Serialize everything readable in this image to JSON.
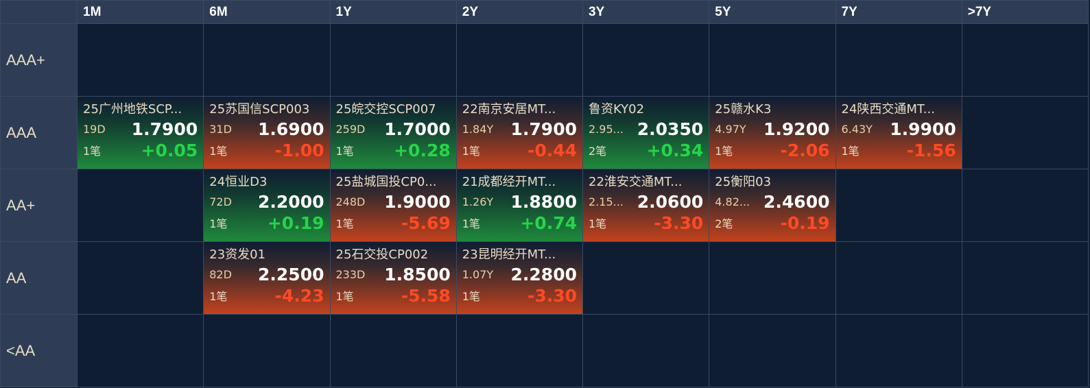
{
  "columns": [
    "1M",
    "6M",
    "1Y",
    "2Y",
    "3Y",
    "5Y",
    "7Y",
    ">7Y"
  ],
  "rows": [
    "AAA+",
    "AAA",
    "AA+",
    "AA",
    "<AA"
  ],
  "colors": {
    "background": "#0f1d33",
    "header": "#2e3d55",
    "up": "#26d44a",
    "down": "#ff4a25"
  },
  "cells": {
    "AAA": {
      "1M": {
        "name": "25广州地铁SCP...",
        "term": "19D",
        "rate": "1.7900",
        "count": "1笔",
        "change": "+0.05",
        "direction": "up"
      },
      "6M": {
        "name": "25苏国信SCP003",
        "term": "31D",
        "rate": "1.6900",
        "count": "1笔",
        "change": "-1.00",
        "direction": "down"
      },
      "1Y": {
        "name": "25皖交控SCP007",
        "term": "259D",
        "rate": "1.7000",
        "count": "1笔",
        "change": "+0.28",
        "direction": "up"
      },
      "2Y": {
        "name": "22南京安居MT...",
        "term": "1.84Y",
        "rate": "1.7900",
        "count": "1笔",
        "change": "-0.44",
        "direction": "down"
      },
      "3Y": {
        "name": "鲁资KY02",
        "term": "2.95...",
        "rate": "2.0350",
        "count": "2笔",
        "change": "+0.34",
        "direction": "up"
      },
      "5Y": {
        "name": "25赣水K3",
        "term": "4.97Y",
        "rate": "1.9200",
        "count": "1笔",
        "change": "-2.06",
        "direction": "down"
      },
      "7Y": {
        "name": "24陕西交通MT...",
        "term": "6.43Y",
        "rate": "1.9900",
        "count": "1笔",
        "change": "-1.56",
        "direction": "down"
      }
    },
    "AA+": {
      "6M": {
        "name": "24恒业D3",
        "term": "72D",
        "rate": "2.2000",
        "count": "1笔",
        "change": "+0.19",
        "direction": "up"
      },
      "1Y": {
        "name": "25盐城国投CP0...",
        "term": "248D",
        "rate": "1.9000",
        "count": "1笔",
        "change": "-5.69",
        "direction": "down"
      },
      "2Y": {
        "name": "21成都经开MT...",
        "term": "1.26Y",
        "rate": "1.8800",
        "count": "1笔",
        "change": "+0.74",
        "direction": "up"
      },
      "3Y": {
        "name": "22淮安交通MT...",
        "term": "2.15...",
        "rate": "2.0600",
        "count": "1笔",
        "change": "-3.30",
        "direction": "down"
      },
      "5Y": {
        "name": "25衡阳03",
        "term": "4.82...",
        "rate": "2.4600",
        "count": "2笔",
        "change": "-0.19",
        "direction": "down"
      }
    },
    "AA": {
      "6M": {
        "name": "23资发01",
        "term": "82D",
        "rate": "2.2500",
        "count": "1笔",
        "change": "-4.23",
        "direction": "down"
      },
      "1Y": {
        "name": "25石交投CP002",
        "term": "233D",
        "rate": "1.8500",
        "count": "1笔",
        "change": "-5.58",
        "direction": "down"
      },
      "2Y": {
        "name": "23昆明经开MT...",
        "term": "1.07Y",
        "rate": "2.2800",
        "count": "1笔",
        "change": "-3.30",
        "direction": "down"
      }
    }
  }
}
